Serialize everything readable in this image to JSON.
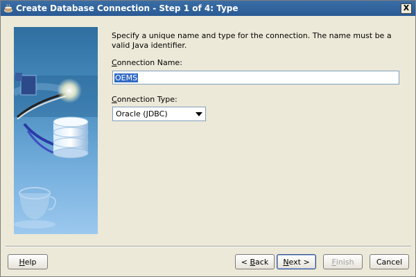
{
  "window": {
    "title": "Create Database Connection - Step 1 of 4: Type",
    "close_label": "X"
  },
  "content": {
    "description": "Specify a unique name and type for the connection. The name must be a valid Java identifier.",
    "connection_name": {
      "label_mnemonic": "C",
      "label_rest": "onnection Name:",
      "value": "OEMS"
    },
    "connection_type": {
      "label_mnemonic": "C",
      "label_rest": "onnection Type:",
      "value": "Oracle (JDBC)"
    }
  },
  "buttons": {
    "help": {
      "mnemonic": "H",
      "rest": "elp"
    },
    "back": {
      "prefix": "< ",
      "mnemonic": "B",
      "rest": "ack"
    },
    "next": {
      "mnemonic": "N",
      "rest": "ext >"
    },
    "finish": {
      "mnemonic": "F",
      "rest": "inish",
      "enabled": false
    },
    "cancel": {
      "label": "Cancel"
    }
  },
  "icons": {
    "title": "coffee-cup-icon",
    "sidebar": "database-wizard-illustration"
  },
  "colors": {
    "titlebar": "#3a6ea5",
    "selection": "#316ac5",
    "sidebar_top": "#2e6fa0",
    "sidebar_bottom": "#9cc8ee"
  }
}
